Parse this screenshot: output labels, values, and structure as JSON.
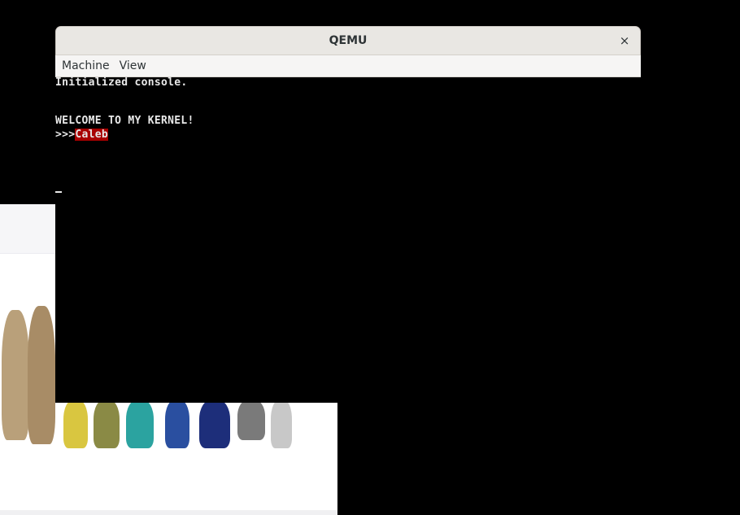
{
  "window": {
    "title": "QEMU",
    "close_glyph": "×"
  },
  "menubar": {
    "items": [
      "Machine",
      "View"
    ]
  },
  "console": {
    "lines": [
      "Initialized console.",
      "WELCOME TO MY KERNEL!"
    ],
    "prompt": ">>>",
    "input": "Caleb"
  },
  "icons": {
    "close": "close-icon"
  },
  "colors": {
    "console_bg": "#000000",
    "console_text": "#e8e8e8",
    "input_highlight": "#a80000",
    "titlebar_bg": "#e9e7e3",
    "menubar_bg": "#f6f5f4"
  }
}
